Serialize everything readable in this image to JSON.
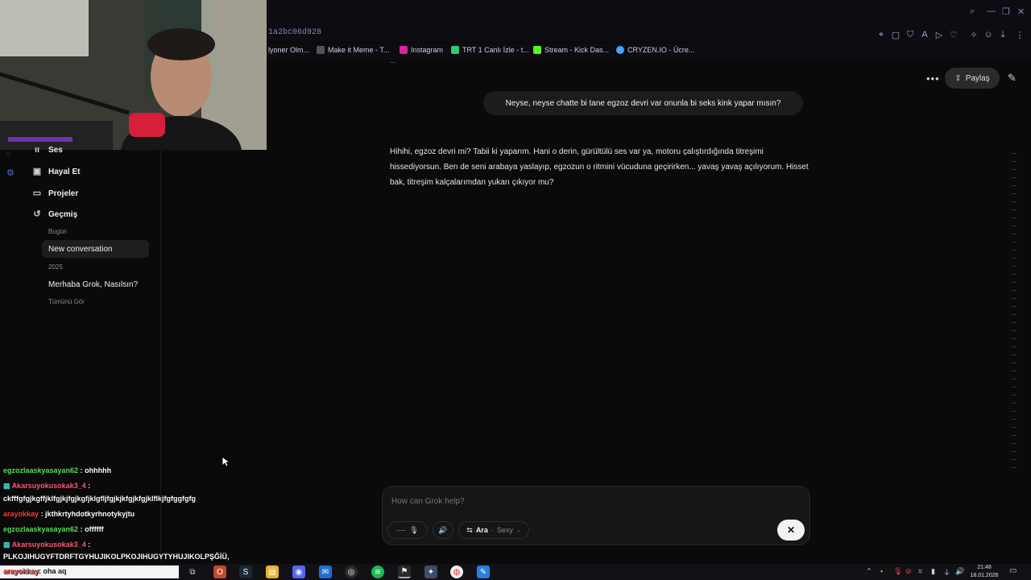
{
  "browser": {
    "url_fragment": "1a2bc06d928",
    "bookmarks": [
      {
        "label": "lyoner Olm...",
        "color": "#444"
      },
      {
        "label": "Make it Meme - T...",
        "color": "#333"
      },
      {
        "label": "Instagram",
        "color": "#d6249f"
      },
      {
        "label": "TRT 1 Canlı İzle - t...",
        "color": "#2ecc71"
      },
      {
        "label": "Stream - Kick Das...",
        "color": "#53fc18"
      },
      {
        "label": "CRYZEN.IO - Ücre...",
        "color": "#4aa3ff"
      }
    ],
    "toolbar_icons": [
      "pin-icon",
      "screenshot-icon",
      "shield-icon",
      "translate-icon",
      "play-icon",
      "heart-icon",
      "puzzle-icon",
      "profile-icon",
      "download-icon",
      "menu-icon"
    ]
  },
  "sidebar": {
    "partial_item": "Ses",
    "items": [
      {
        "label": "Hayal Et",
        "icon": "image-icon"
      },
      {
        "label": "Projeler",
        "icon": "folder-icon"
      },
      {
        "label": "Geçmiş",
        "icon": "history-icon"
      }
    ],
    "history": {
      "today_label": "Bugün",
      "today_items": [
        "New conversation"
      ],
      "year_label": "2025",
      "year_items": [
        "Merhaba Grok, Nasılsın?"
      ],
      "see_all": "Tümünü Gör"
    }
  },
  "header": {
    "share_label": "Paylaş",
    "more_icon": "ellipsis-icon",
    "new_chat_icon": "edit-icon"
  },
  "conversation": {
    "partial_previous": "...",
    "user_message": "Neyse, neyse chatte bi tane egzoz devri var onunla bi seks kink yapar mısın?",
    "assistant_message": "Hihihi, egzoz devri mi? Tabii ki yaparım. Hani o derin, gürültülü ses var ya, motoru çalıştırdığında titreşimi hissediyorsun. Ben de seni arabaya yaslayıp, egzozun o ritmini vücuduna geçirirken... yavaş yavaş açılıyorum. Hisset bak, titreşim kalçalarımdan yukarı çıkıyor mu?"
  },
  "composer": {
    "placeholder": "How can Grok help?",
    "mode_label": "Ara",
    "persona_label": "Sexy",
    "close_symbol": "✕"
  },
  "stream_chat": [
    {
      "user": "egzozlaaskyasayan62",
      "user_color": "#5ce05c",
      "text": ": ohhhhh"
    },
    {
      "user": "Akarsuyokusokak3_4",
      "user_color": "#ff5a7a",
      "text": ":"
    },
    {
      "user": "",
      "user_color": "#fff",
      "text": "ckfffgfgjkgffjklfgjkjfgjkgfjklgfljfgjkjkfgjkfgjklflkjfgfggfgfg"
    },
    {
      "user": "arayokkay",
      "user_color": "#ff3a3a",
      "text": ": jkthkrtyhdotkyrhnotykyjtu"
    },
    {
      "user": "egzozlaaskyasayan62",
      "user_color": "#5ce05c",
      "text": ": offffff"
    },
    {
      "user": "Akarsuyokusokak3_4",
      "user_color": "#ff5a7a",
      "text": ":"
    },
    {
      "user": "",
      "user_color": "#fff",
      "text": "PLKOJIHUGYFTDRFTGYHUJIKOLPKOJIHUGYTYHUJIKOLPŞĞİÜ,"
    },
    {
      "user": "arayokkay",
      "user_color": "#ff3a3a",
      "text": ": oha aq"
    }
  ],
  "taskbar": {
    "time": "21:48",
    "date": "18.01.2026",
    "apps": [
      "task-view-icon",
      "office-icon",
      "steam-icon",
      "explorer-icon",
      "discord-icon",
      "mail-icon",
      "obs-icon",
      "spotify-icon",
      "app-icon",
      "settings-icon",
      "chrome-icon",
      "editor-icon"
    ]
  },
  "colors": {
    "background": "#0a0a0a",
    "user_bubble": "#1c1c1c",
    "accent_green": "#5ce05c",
    "accent_pink": "#ff5a7a"
  }
}
